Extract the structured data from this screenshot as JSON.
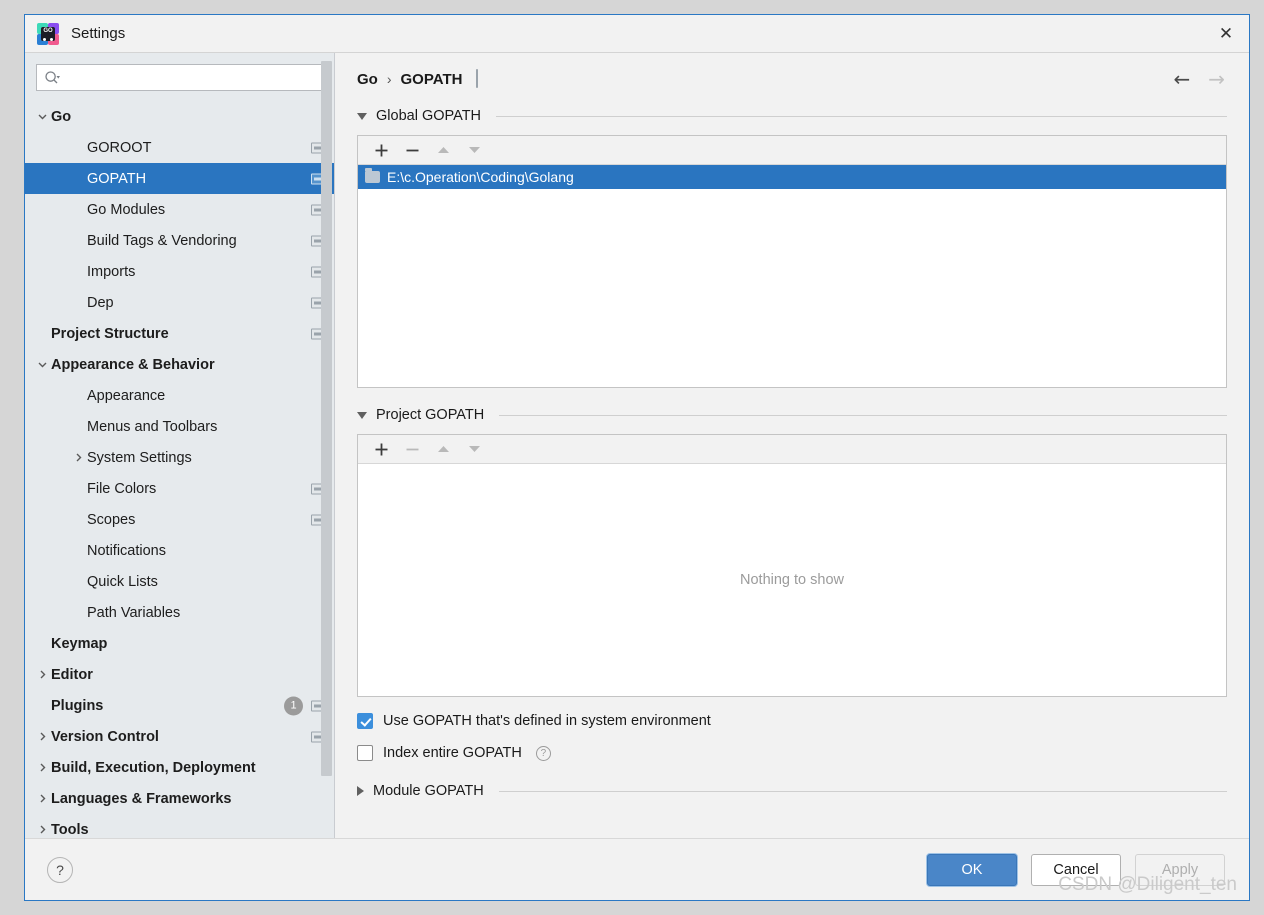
{
  "window": {
    "title": "Settings",
    "app_icon": "goland-icon",
    "close_label": "✕"
  },
  "search": {
    "placeholder": "",
    "value": "",
    "icon": "search-icon"
  },
  "sidebar": {
    "items": [
      {
        "label": "Go",
        "indent": 0,
        "twisty": "down",
        "bold": true,
        "cfg": false,
        "selected": false
      },
      {
        "label": "GOROOT",
        "indent": 1,
        "twisty": "",
        "bold": false,
        "cfg": true,
        "selected": false
      },
      {
        "label": "GOPATH",
        "indent": 1,
        "twisty": "",
        "bold": false,
        "cfg": true,
        "selected": true
      },
      {
        "label": "Go Modules",
        "indent": 1,
        "twisty": "",
        "bold": false,
        "cfg": true,
        "selected": false
      },
      {
        "label": "Build Tags & Vendoring",
        "indent": 1,
        "twisty": "",
        "bold": false,
        "cfg": true,
        "selected": false
      },
      {
        "label": "Imports",
        "indent": 1,
        "twisty": "",
        "bold": false,
        "cfg": true,
        "selected": false
      },
      {
        "label": "Dep",
        "indent": 1,
        "twisty": "",
        "bold": false,
        "cfg": true,
        "selected": false
      },
      {
        "label": "Project Structure",
        "indent": 0,
        "twisty": "",
        "bold": true,
        "cfg": true,
        "selected": false
      },
      {
        "label": "Appearance & Behavior",
        "indent": 0,
        "twisty": "down",
        "bold": true,
        "cfg": false,
        "selected": false
      },
      {
        "label": "Appearance",
        "indent": 1,
        "twisty": "",
        "bold": false,
        "cfg": false,
        "selected": false
      },
      {
        "label": "Menus and Toolbars",
        "indent": 1,
        "twisty": "",
        "bold": false,
        "cfg": false,
        "selected": false
      },
      {
        "label": "System Settings",
        "indent": 1,
        "twisty": "right",
        "bold": false,
        "cfg": false,
        "selected": false
      },
      {
        "label": "File Colors",
        "indent": 1,
        "twisty": "",
        "bold": false,
        "cfg": true,
        "selected": false
      },
      {
        "label": "Scopes",
        "indent": 1,
        "twisty": "",
        "bold": false,
        "cfg": true,
        "selected": false
      },
      {
        "label": "Notifications",
        "indent": 1,
        "twisty": "",
        "bold": false,
        "cfg": false,
        "selected": false
      },
      {
        "label": "Quick Lists",
        "indent": 1,
        "twisty": "",
        "bold": false,
        "cfg": false,
        "selected": false
      },
      {
        "label": "Path Variables",
        "indent": 1,
        "twisty": "",
        "bold": false,
        "cfg": false,
        "selected": false
      },
      {
        "label": "Keymap",
        "indent": 0,
        "twisty": "",
        "bold": true,
        "cfg": false,
        "selected": false
      },
      {
        "label": "Editor",
        "indent": 0,
        "twisty": "right",
        "bold": true,
        "cfg": false,
        "selected": false
      },
      {
        "label": "Plugins",
        "indent": 0,
        "twisty": "",
        "bold": true,
        "cfg": true,
        "badge": "1",
        "selected": false
      },
      {
        "label": "Version Control",
        "indent": 0,
        "twisty": "right",
        "bold": true,
        "cfg": true,
        "selected": false
      },
      {
        "label": "Build, Execution, Deployment",
        "indent": 0,
        "twisty": "right",
        "bold": true,
        "cfg": false,
        "selected": false
      },
      {
        "label": "Languages & Frameworks",
        "indent": 0,
        "twisty": "right",
        "bold": true,
        "cfg": false,
        "selected": false
      },
      {
        "label": "Tools",
        "indent": 0,
        "twisty": "right",
        "bold": true,
        "cfg": false,
        "selected": false
      }
    ]
  },
  "breadcrumb": {
    "root": "Go",
    "separator": "›",
    "current": "GOPATH",
    "cfg_icon": "settings-sync-icon"
  },
  "nav": {
    "back": "←",
    "forward": "→"
  },
  "global_gopath": {
    "title": "Global GOPATH",
    "expanded": true,
    "toolbar": {
      "add": "+",
      "remove": "−",
      "up": "▲",
      "down": "▼",
      "add_enabled": true,
      "remove_enabled": true,
      "up_enabled": false,
      "down_enabled": false
    },
    "rows": [
      {
        "path": "E:\\c.Operation\\Coding\\Golang",
        "selected": true
      }
    ]
  },
  "project_gopath": {
    "title": "Project GOPATH",
    "expanded": true,
    "toolbar": {
      "add": "+",
      "remove": "−",
      "up": "▲",
      "down": "▼",
      "add_enabled": true,
      "remove_enabled": false,
      "up_enabled": false,
      "down_enabled": false
    },
    "empty_text": "Nothing to show"
  },
  "options": [
    {
      "label": "Use GOPATH that's defined in system environment",
      "checked": true,
      "help": false
    },
    {
      "label": "Index entire GOPATH",
      "checked": false,
      "help": true,
      "help_glyph": "?"
    }
  ],
  "module_gopath": {
    "title": "Module GOPATH",
    "expanded": false
  },
  "footer": {
    "help_glyph": "?",
    "ok": "OK",
    "cancel": "Cancel",
    "apply": "Apply",
    "apply_enabled": false
  },
  "watermark": "CSDN @Diligent_ten",
  "colors": {
    "accent": "#2a75c0",
    "primary_button": "#4a86c8",
    "sidebar_bg": "#e6eaed",
    "panel_bg": "#f2f2f2",
    "checkbox_checked": "#3c8fdc"
  }
}
